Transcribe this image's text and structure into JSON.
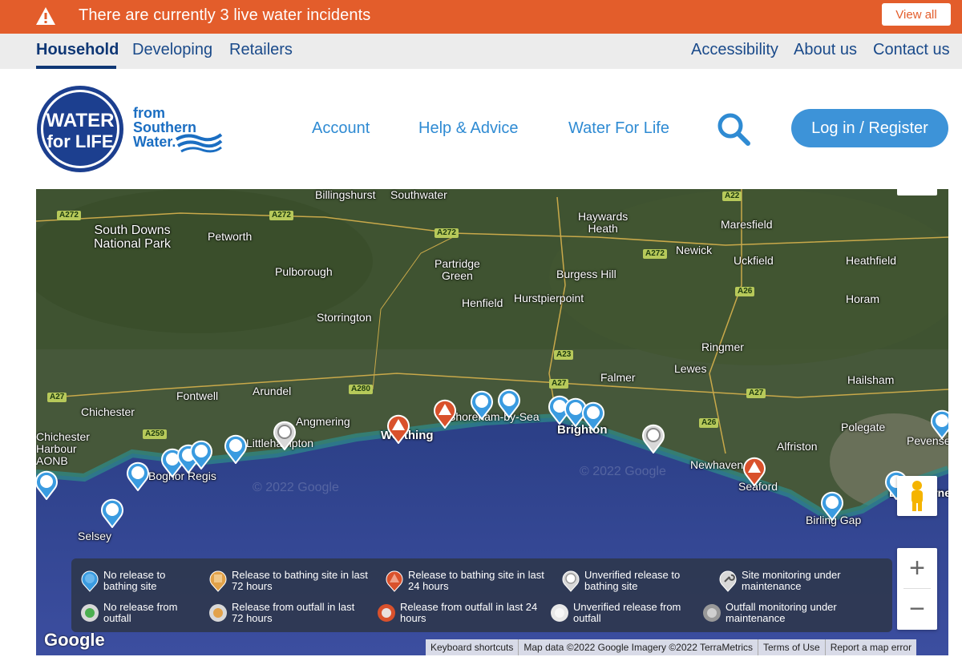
{
  "banner": {
    "message": "There are currently 3 live water incidents",
    "view_all_label": "View all",
    "color": "#e35d2b"
  },
  "audience_nav": {
    "items": [
      "Household",
      "Developing",
      "Retailers"
    ],
    "right_items": [
      "Accessibility",
      "About us",
      "Contact us"
    ],
    "active": "Household"
  },
  "header": {
    "logo_text_line1": "WATER",
    "logo_text_line2": "for LIFE",
    "logo_from": [
      "from",
      "Southern",
      "Water."
    ],
    "nav": [
      "Account",
      "Help & Advice",
      "Water For Life"
    ],
    "login_label": "Log in / Register",
    "accent_color": "#3d93d8"
  },
  "map": {
    "places": [
      {
        "name": "Billingshurst"
      },
      {
        "name": "Southwater"
      },
      {
        "name": "South Downs\nNational Park"
      },
      {
        "name": "Petworth"
      },
      {
        "name": "Haywards\nHeath"
      },
      {
        "name": "Maresfield"
      },
      {
        "name": "Newick"
      },
      {
        "name": "Uckfield"
      },
      {
        "name": "Heathfield"
      },
      {
        "name": "Pulborough"
      },
      {
        "name": "Partridge\nGreen"
      },
      {
        "name": "Burgess Hill"
      },
      {
        "name": "Henfield"
      },
      {
        "name": "Hurstpierpoint"
      },
      {
        "name": "Horam"
      },
      {
        "name": "Storrington"
      },
      {
        "name": "Ringmer"
      },
      {
        "name": "Lewes"
      },
      {
        "name": "Falmer"
      },
      {
        "name": "Hailsham"
      },
      {
        "name": "Fontwell"
      },
      {
        "name": "Arundel"
      },
      {
        "name": "Chichester"
      },
      {
        "name": "Angmering"
      },
      {
        "name": "Worthing"
      },
      {
        "name": "Shoreham-by-Sea"
      },
      {
        "name": "Brighton"
      },
      {
        "name": "Littlehampton"
      },
      {
        "name": "Polegate"
      },
      {
        "name": "Alfriston"
      },
      {
        "name": "Pevensey"
      },
      {
        "name": "Chichester Harbour AONB"
      },
      {
        "name": "Bognor Regis"
      },
      {
        "name": "Newhaven"
      },
      {
        "name": "Seaford"
      },
      {
        "name": "Eastbourne"
      },
      {
        "name": "Selsey"
      },
      {
        "name": "Birling Gap"
      }
    ],
    "roads": [
      "A272",
      "A272",
      "A272",
      "A272",
      "A22",
      "A26",
      "A23",
      "A27",
      "A27",
      "A280",
      "A27",
      "A259",
      "A26"
    ],
    "watermarks": [
      "© 2022 Google",
      "© 2022 Google"
    ],
    "legend": [
      {
        "label": "No release to bathing site",
        "color": "#3a9be0",
        "icon": "pin"
      },
      {
        "label": "Release to bathing site in last 72 hours",
        "color": "#e2a24a",
        "icon": "pin-square"
      },
      {
        "label": "Release to bathing site in last 24 hours",
        "color": "#d9512c",
        "icon": "pin-triangle"
      },
      {
        "label": "Unverified release to bathing site",
        "color": "#d8d8d8",
        "icon": "pin"
      },
      {
        "label": "Site monitoring under maintenance",
        "color": "#555555",
        "icon": "wrench"
      },
      {
        "label": "No release from outfall",
        "color": "#4caf50",
        "icon": "dot"
      },
      {
        "label": "Release from outfall in last 72 hours",
        "color": "#e2a24a",
        "icon": "dot"
      },
      {
        "label": "Release from outfall in last 24 hours",
        "color": "#d9512c",
        "icon": "dot"
      },
      {
        "label": "Unverified release from outfall",
        "color": "#e8e8e8",
        "icon": "dot"
      },
      {
        "label": "Outfall monitoring under maintenance",
        "color": "#777777",
        "icon": "dot"
      }
    ],
    "google_label": "Google",
    "attribution": [
      "Keyboard shortcuts",
      "Map data ©2022 Google Imagery ©2022 TerraMetrics",
      "Terms of Use",
      "Report a map error"
    ],
    "zoom_in": "+",
    "zoom_out": "−"
  }
}
